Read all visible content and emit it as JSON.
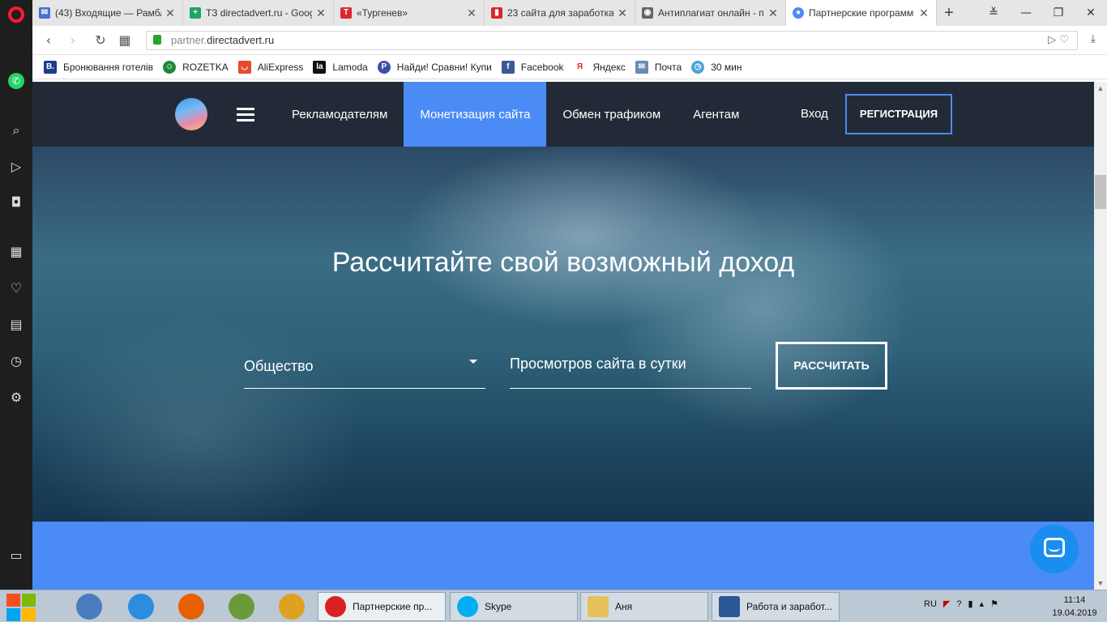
{
  "browser": {
    "tabs": [
      {
        "title": "(43) Входящие — Рамбл",
        "icon_color": "#4a6fd1",
        "icon_char": "✉"
      },
      {
        "title": "ТЗ directadvert.ru - Goog",
        "icon_color": "#1fa463",
        "icon_char": "+"
      },
      {
        "title": "«Тургенев»",
        "icon_color": "#d9272e",
        "icon_char": "T"
      },
      {
        "title": "23 сайта для заработка",
        "icon_color": "#d9272e",
        "icon_char": "▮"
      },
      {
        "title": "Антиплагиат онлайн - п",
        "icon_color": "#666666",
        "icon_char": "◉"
      },
      {
        "title": "Партнерские программ",
        "icon_color": "#4b8bf5",
        "icon_char": "●"
      }
    ],
    "url_host": "partner.",
    "url_domain": "directadvert.ru",
    "bookmarks": [
      {
        "label": "Бронювання готелів",
        "icon_color": "#1f3b8c",
        "icon_char": "B."
      },
      {
        "label": "ROZETKA",
        "icon_color": "#1c8a3a",
        "icon_char": "☺"
      },
      {
        "label": "AliExpress",
        "icon_color": "#e8492c",
        "icon_char": "◡"
      },
      {
        "label": "Lamoda",
        "icon_color": "#111111",
        "icon_char": "la"
      },
      {
        "label": "Найди! Сравни! Купи",
        "icon_color": "#3a4fa8",
        "icon_char": "P"
      },
      {
        "label": "Facebook",
        "icon_color": "#3b5998",
        "icon_char": "f"
      },
      {
        "label": "Яндекс",
        "icon_color": "#ffffff",
        "icon_char": "Я"
      },
      {
        "label": "Почта",
        "icon_color": "#6b8bb5",
        "icon_char": "✉"
      },
      {
        "label": "30 мин",
        "icon_color": "#4aa3d9",
        "icon_char": "◷"
      }
    ]
  },
  "site": {
    "nav": [
      "Рекламодателям",
      "Монетизация сайта",
      "Обмен трафиком",
      "Агентам"
    ],
    "login": "Вход",
    "register": "РЕГИСТРАЦИЯ",
    "hero_title": "Рассчитайте свой возможный доход",
    "category_value": "Общество",
    "views_placeholder": "Просмотров сайта в сутки",
    "calc_button": "РАССЧИТАТЬ",
    "accent_color": "#4b8bf5"
  },
  "taskbar": {
    "tasks": [
      {
        "label": "Партнерские пр...",
        "icon_color": "#d92121"
      },
      {
        "label": "Skype",
        "icon_color": "#00aff0"
      },
      {
        "label": "Аня",
        "icon_color": "#e6c15a"
      },
      {
        "label": "Работа и заработ...",
        "icon_color": "#2b5797"
      }
    ],
    "lang": "RU",
    "time": "11:14",
    "date": "19.04.2019"
  }
}
